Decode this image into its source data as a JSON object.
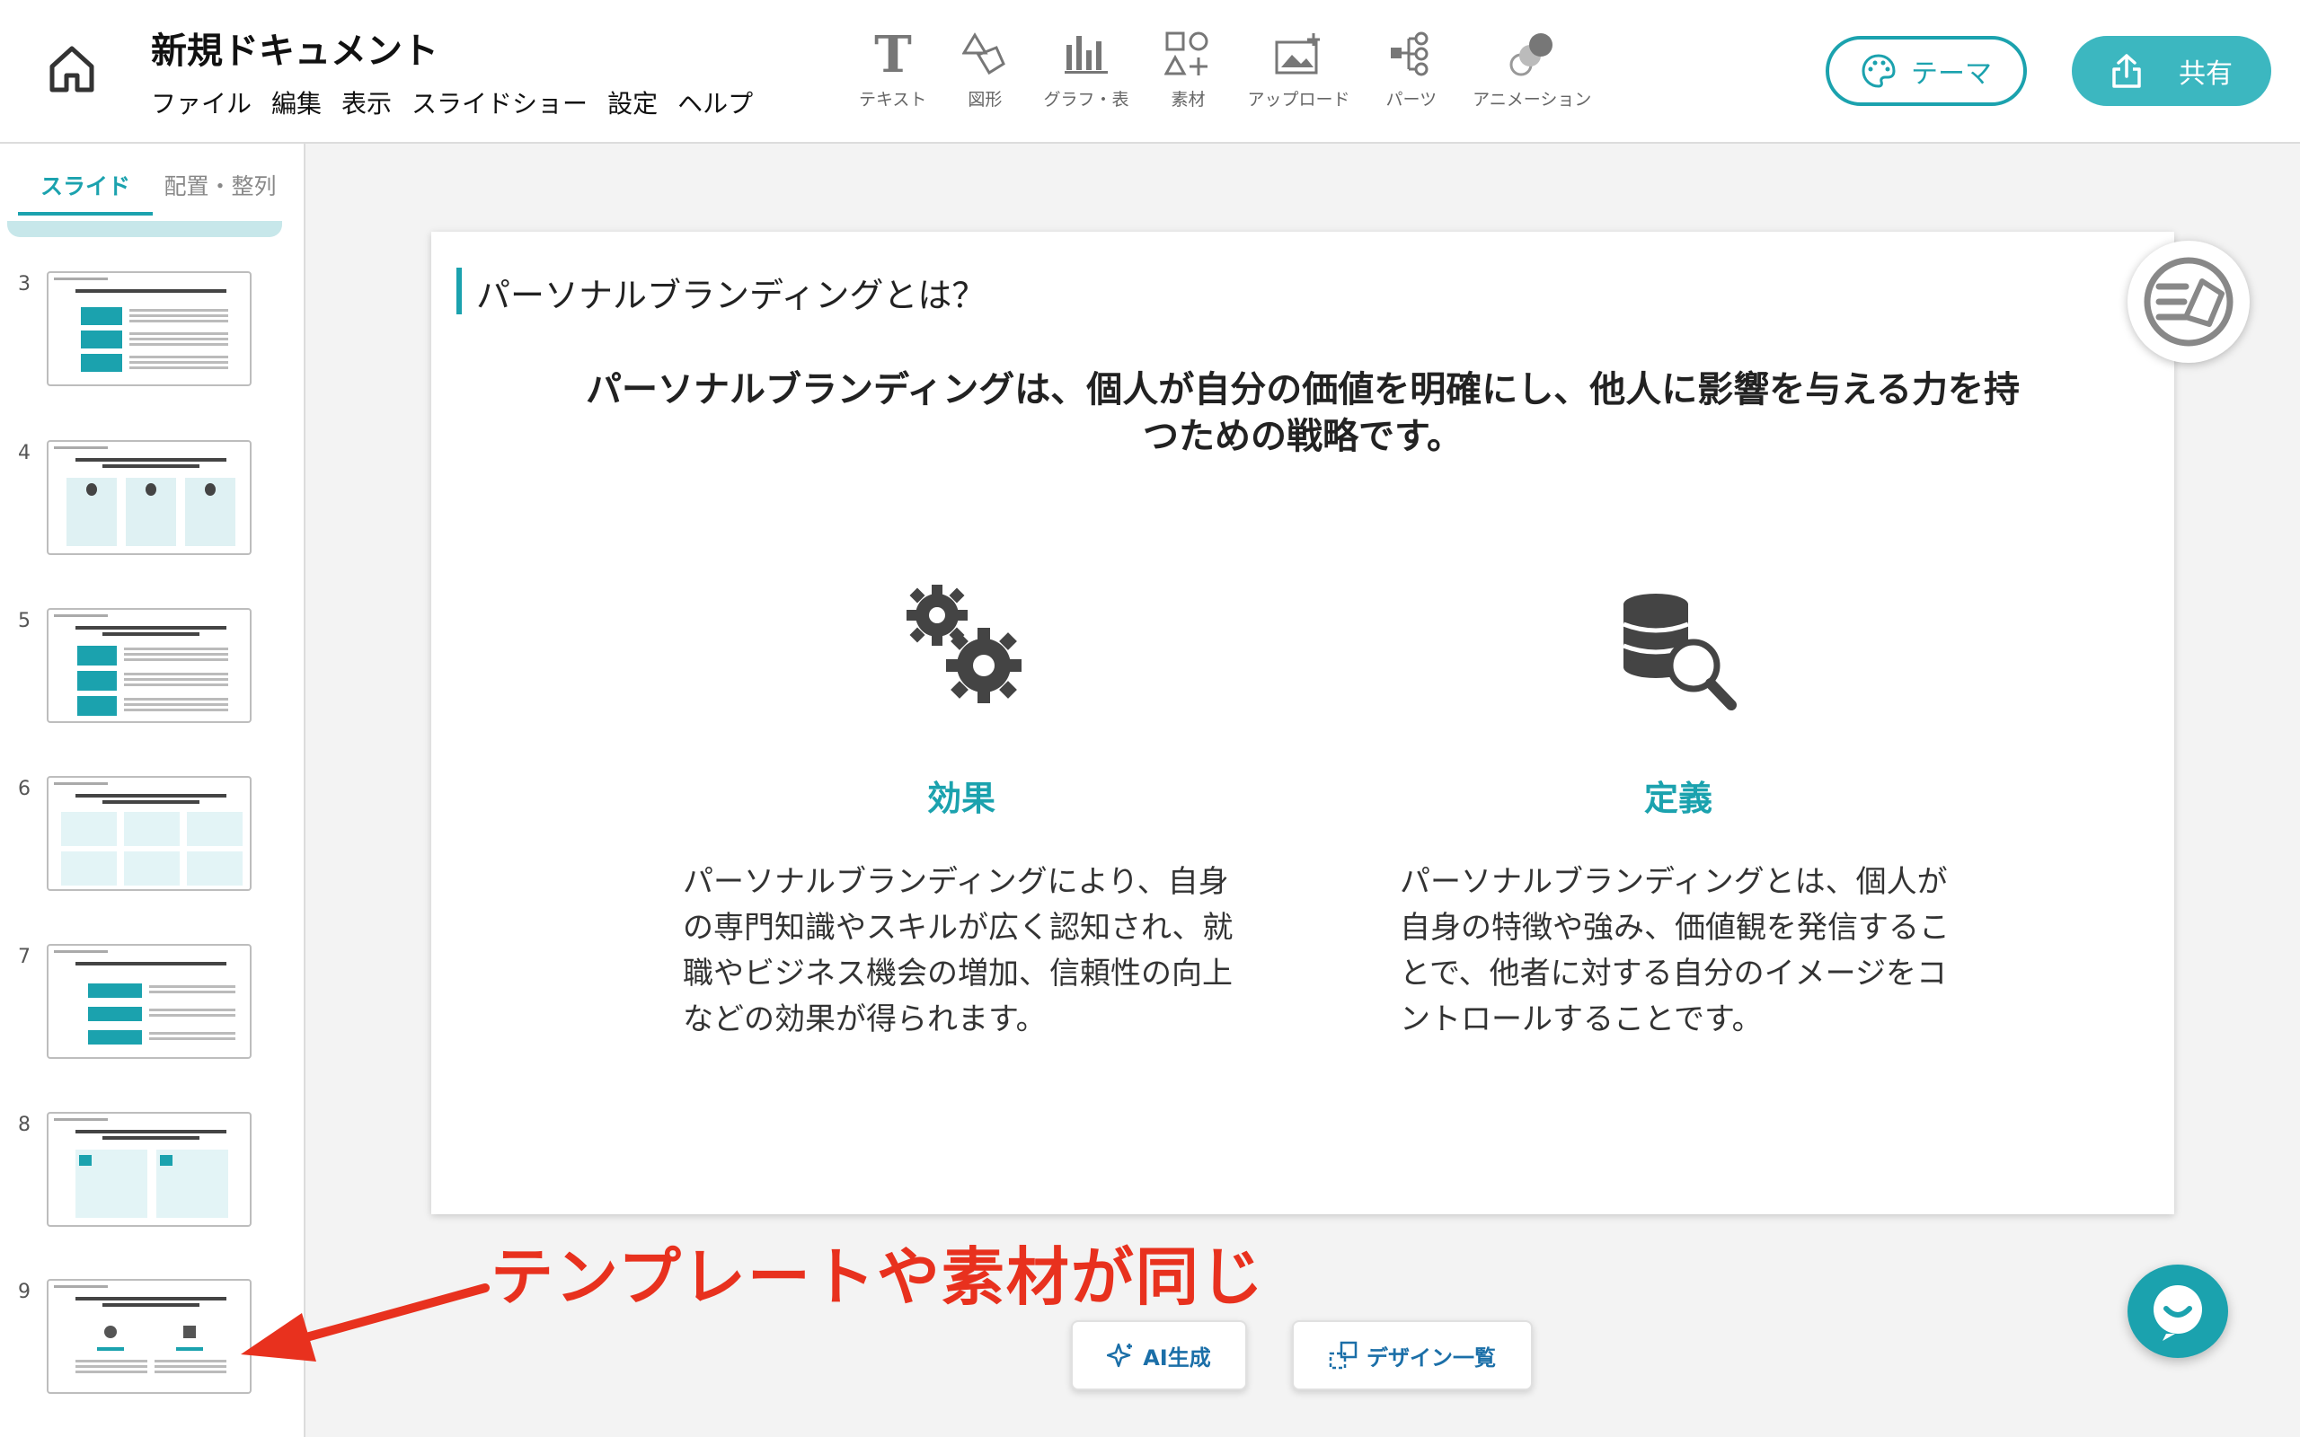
{
  "header": {
    "doc_title": "新規ドキュメント",
    "menu": [
      "ファイル",
      "編集",
      "表示",
      "スライドショー",
      "設定",
      "ヘルプ"
    ],
    "tools": [
      {
        "label": "テキスト",
        "icon": "text-icon"
      },
      {
        "label": "図形",
        "icon": "shapes-icon"
      },
      {
        "label": "グラフ・表",
        "icon": "chart-icon"
      },
      {
        "label": "素材",
        "icon": "assets-icon"
      },
      {
        "label": "アップロード",
        "icon": "upload-image-icon"
      },
      {
        "label": "パーツ",
        "icon": "parts-icon"
      },
      {
        "label": "アニメーション",
        "icon": "animation-icon"
      }
    ],
    "theme_label": "テーマ",
    "share_label": "共有"
  },
  "sidebar": {
    "tabs": [
      "スライド",
      "配置・整列"
    ],
    "active_tab": "スライド",
    "thumbnails": [
      {
        "num": "3"
      },
      {
        "num": "4"
      },
      {
        "num": "5"
      },
      {
        "num": "6"
      },
      {
        "num": "7"
      },
      {
        "num": "8"
      },
      {
        "num": "9"
      }
    ]
  },
  "slide": {
    "title": "パーソナルブランディングとは？",
    "lead": "パーソナルブランディングは、個人が自分の価値を明確にし、他人に影響を与える力を持つための戦略です。",
    "columns": [
      {
        "heading": "効果",
        "icon": "gears-icon",
        "body": "パーソナルブランディングにより、自身の専門知識やスキルが広く認知され、就職やビジネス機会の増加、信頼性の向上などの効果が得られます。"
      },
      {
        "heading": "定義",
        "icon": "database-search-icon",
        "body": "パーソナルブランディングとは、個人が自身の特徴や強み、価値観を発信することで、他者に対する自分のイメージをコントロールすることです。"
      }
    ]
  },
  "annotation": "テンプレートや素材が同じ",
  "bottom": {
    "ai_label": "AI生成",
    "design_label": "デザイン一覧"
  },
  "colors": {
    "accent": "#1ba2ae",
    "annotation_red": "#e8311e",
    "link_blue": "#1b6fa8"
  }
}
